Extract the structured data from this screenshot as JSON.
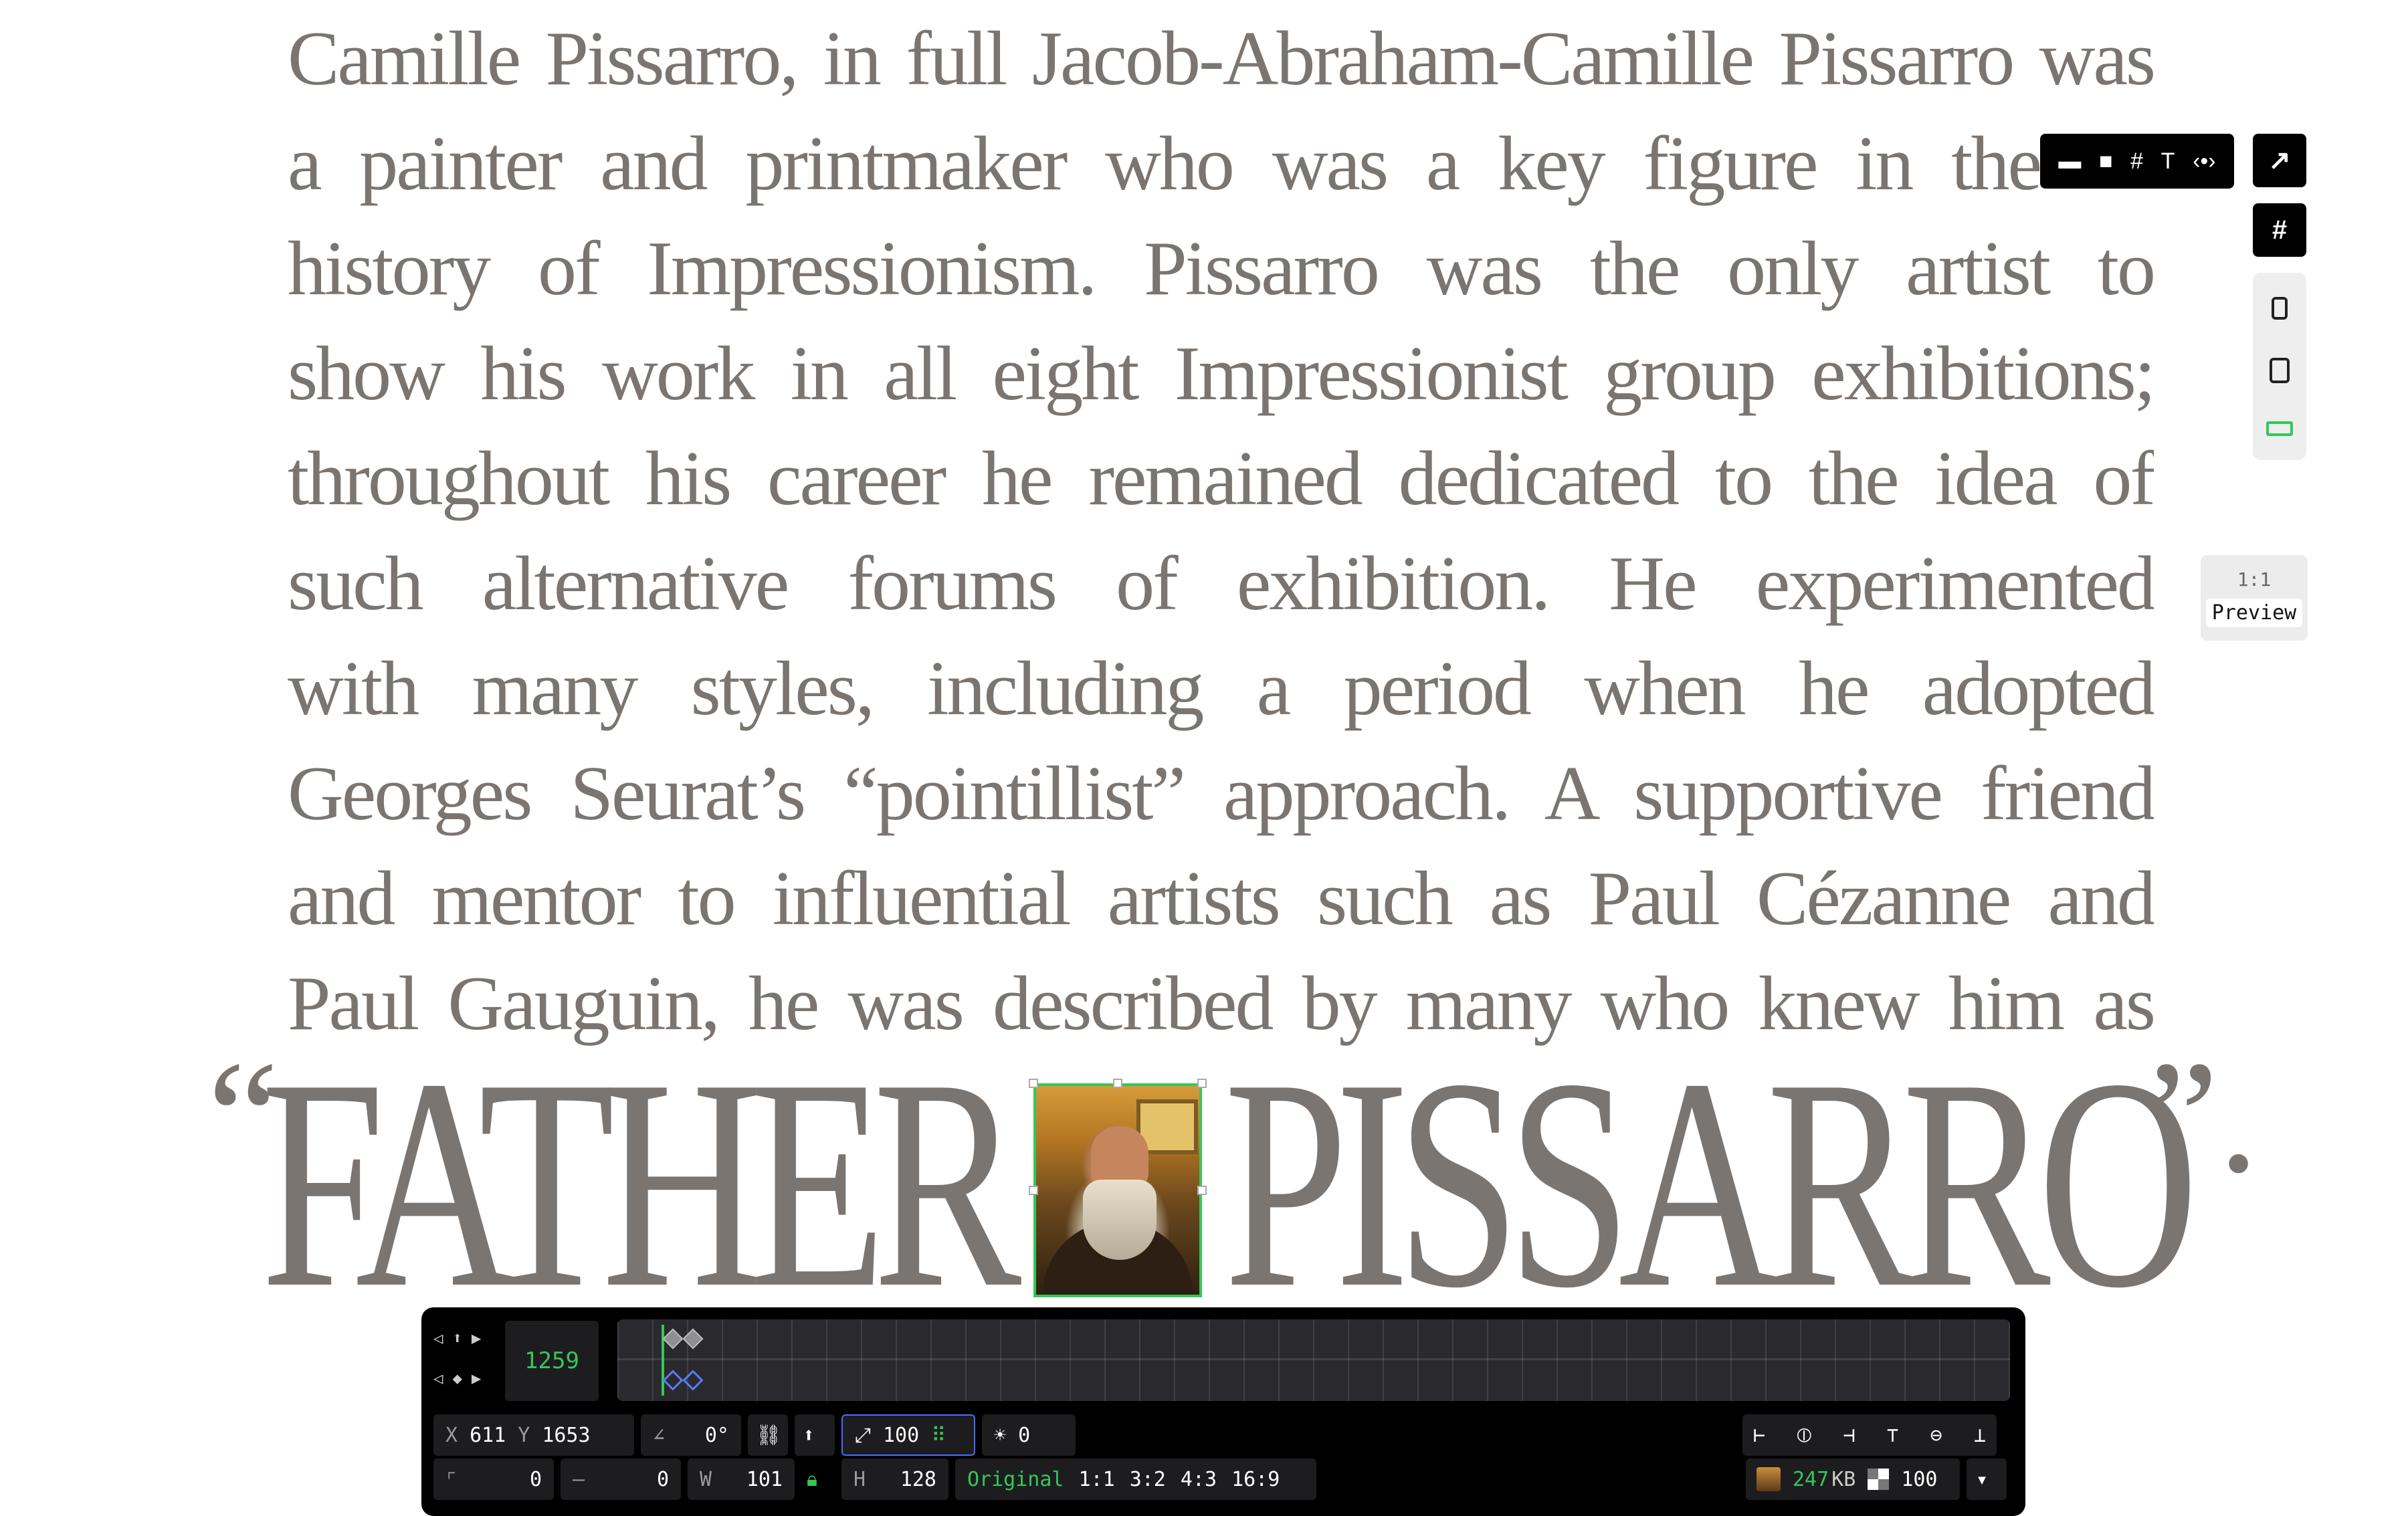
{
  "article": {
    "lines": [
      "Camille Pissarro, in full Jacob-Abraham-Camille Pissarro was",
      "a painter and printmaker who was a key figure in the",
      "history of Impressionism. Pissarro was the only artist to",
      "show his work in all eight Impressionist group exhibitions;",
      "throughout his career he remained dedicated to the idea of",
      "such alternative forums of exhibition. He experimented",
      "with many styles, including a period when he adopted",
      "Georges Seurat’s “pointillist” approach. A supportive friend",
      "and mentor to influential artists such as Paul Cézanne and",
      "Paul Gauguin, he was described by many who knew him as"
    ],
    "big_open_quote": "“",
    "big_word_1": "FATHER",
    "big_word_2": "PISSARRO",
    "big_close": "”."
  },
  "toolbar": {
    "icons": [
      "folder-icon",
      "square-icon",
      "grid-icon",
      "text-icon",
      "code-icon"
    ],
    "text_tool_glyph": "T",
    "code_tool_glyph": "‹•›",
    "expand_glyph": "↗",
    "grid_glyph": "#"
  },
  "preview": {
    "ratio": "1:1",
    "button": "Preview"
  },
  "timeline": {
    "frame": "1259"
  },
  "props": {
    "x_label": "X",
    "x_value": "611",
    "y_label": "Y",
    "y_value": "1653",
    "angle_value": "0°",
    "scale_value": "100",
    "brightness_value": "0",
    "radius_value": "0",
    "stroke_value": "0",
    "w_label": "W",
    "w_value": "101",
    "h_label": "H",
    "h_value": "128",
    "ratio_options": [
      "Original",
      "1:1",
      "3:2",
      "4:3",
      "16:9"
    ],
    "file_size": "247",
    "file_unit": "KB",
    "opacity": "100"
  },
  "colors": {
    "text": "#7b7571",
    "accent": "#35c759",
    "selection": "#4c6bff",
    "panel": "#000000"
  }
}
